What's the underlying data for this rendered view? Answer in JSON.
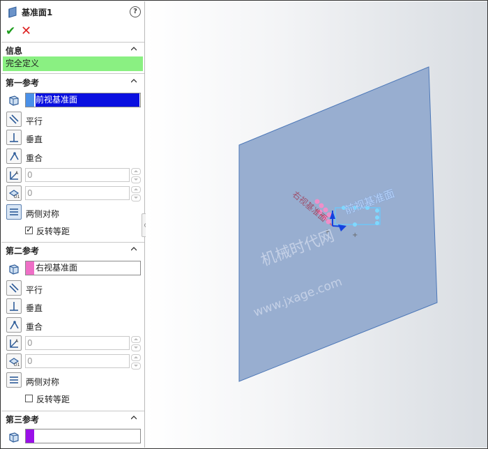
{
  "panel": {
    "title": "基准面1",
    "help_icon": "?",
    "ok_icon": "✔",
    "cancel_icon": "✕"
  },
  "info": {
    "header": "信息",
    "status": "完全定义",
    "status_color": "#8af082"
  },
  "ref1": {
    "header": "第一参考",
    "selection": "前视基准面",
    "swatch_color": "#4a90e8",
    "selected_bg": "#0a10e0",
    "options": {
      "parallel": "平行",
      "perpendicular": "垂直",
      "coincident": "重合"
    },
    "angle_value": "0",
    "distance_value": "0",
    "midplane": "两侧对称",
    "flip_offset": "反转等距",
    "flip_checked": true
  },
  "ref2": {
    "header": "第二参考",
    "selection": "右视基准面",
    "swatch_color": "#ee6fc6",
    "options": {
      "parallel": "平行",
      "perpendicular": "垂直",
      "coincident": "重合"
    },
    "angle_value": "0",
    "distance_value": "0",
    "midplane": "两侧对称",
    "flip_offset": "反转等距",
    "flip_checked": false
  },
  "ref3": {
    "header": "第三参考",
    "selection": "",
    "swatch_color": "#9a10e8"
  },
  "viewport": {
    "plane_label": "前视基准面",
    "preview_label": "右视基准面",
    "plane_fill": "#98aed0",
    "plane_edge": "#4d78b8",
    "watermark_cn": "机械时代网",
    "watermark_url": "www.jxage.com"
  }
}
